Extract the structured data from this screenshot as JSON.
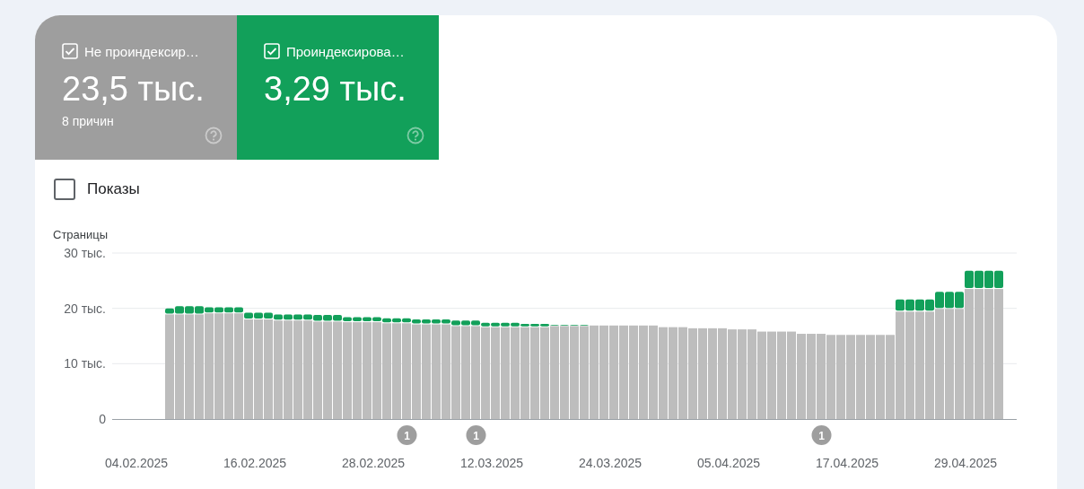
{
  "tiles": [
    {
      "label": "Не проиндексир…",
      "checked": true,
      "value": "23,5 тыс.",
      "subtitle": "8 причин",
      "color": "#9e9e9e"
    },
    {
      "label": "Проиндексирова…",
      "checked": true,
      "value": "3,29 тыс.",
      "color": "#12a05a"
    }
  ],
  "impressions": {
    "label": "Показы",
    "checked": false
  },
  "chart": {
    "chart_data": {
      "type": "bar",
      "stacked": true,
      "ylabel": "Страницы",
      "ylim": [
        0,
        30
      ],
      "yticks": [
        {
          "value": 0,
          "label": "0"
        },
        {
          "value": 10,
          "label": "10 тыс."
        },
        {
          "value": 20,
          "label": "20 тыс."
        },
        {
          "value": 30,
          "label": "30 тыс."
        }
      ],
      "categories": [
        "04.02.2025",
        null,
        null,
        null,
        null,
        null,
        null,
        null,
        null,
        null,
        null,
        null,
        "16.02.2025",
        null,
        null,
        null,
        null,
        null,
        null,
        null,
        null,
        null,
        null,
        null,
        "28.02.2025",
        null,
        null,
        null,
        null,
        null,
        null,
        null,
        null,
        null,
        null,
        null,
        "12.03.2025",
        null,
        null,
        null,
        null,
        null,
        null,
        null,
        null,
        null,
        null,
        null,
        "24.03.2025",
        null,
        null,
        null,
        null,
        null,
        null,
        null,
        null,
        null,
        null,
        null,
        "05.04.2025",
        null,
        null,
        null,
        null,
        null,
        null,
        null,
        null,
        null,
        null,
        null,
        "17.04.2025",
        null,
        null,
        null,
        null,
        null,
        null,
        null,
        null,
        null,
        null,
        null,
        "29.04.2025",
        null,
        null,
        null
      ],
      "series": [
        {
          "color": "#bdbdbd",
          "values": [
            null,
            null,
            null,
            18.9,
            18.9,
            18.9,
            18.9,
            19.1,
            19.1,
            19.1,
            19.1,
            18.0,
            18.0,
            18.0,
            17.8,
            17.8,
            17.8,
            17.8,
            17.6,
            17.6,
            17.6,
            17.5,
            17.5,
            17.5,
            17.5,
            17.3,
            17.3,
            17.3,
            17.1,
            17.1,
            17.1,
            17.1,
            16.8,
            16.8,
            16.8,
            16.6,
            16.6,
            16.6,
            16.6,
            16.6,
            16.6,
            16.6,
            16.8,
            16.8,
            16.8,
            16.8,
            16.9,
            16.9,
            16.9,
            16.9,
            16.9,
            16.9,
            16.9,
            16.6,
            16.6,
            16.6,
            16.4,
            16.4,
            16.4,
            16.4,
            16.2,
            16.2,
            16.2,
            15.8,
            15.8,
            15.8,
            15.8,
            15.4,
            15.4,
            15.4,
            15.2,
            15.2,
            15.2,
            15.2,
            15.2,
            15.2,
            15.2,
            19.4,
            19.4,
            19.4,
            19.4,
            19.9,
            19.9,
            19.9,
            23.5,
            23.5,
            23.5,
            23.5
          ]
        },
        {
          "color": "#12a05a",
          "values": [
            null,
            null,
            null,
            1.1,
            1.5,
            1.5,
            1.5,
            1.1,
            1.1,
            1.1,
            1.1,
            1.2,
            1.2,
            1.2,
            1.1,
            1.1,
            1.1,
            1.1,
            1.2,
            1.2,
            1.2,
            0.9,
            0.9,
            0.9,
            0.9,
            0.9,
            0.9,
            0.9,
            0.9,
            0.9,
            0.9,
            0.9,
            1.0,
            1.0,
            1.0,
            0.8,
            0.8,
            0.8,
            0.8,
            0.6,
            0.6,
            0.6,
            0.2,
            0.2,
            0.2,
            0.2,
            0,
            0,
            0,
            0,
            0,
            0,
            0,
            0,
            0,
            0,
            0,
            0,
            0,
            0,
            0,
            0,
            0,
            0,
            0,
            0,
            0,
            0,
            0,
            0,
            0,
            0,
            0,
            0,
            0,
            0,
            0,
            2.2,
            2.2,
            2.2,
            2.2,
            3.1,
            3.1,
            3.1,
            3.3,
            3.3,
            3.3,
            3.3
          ]
        }
      ],
      "annotations": [
        "1",
        "1",
        "1"
      ]
    }
  }
}
